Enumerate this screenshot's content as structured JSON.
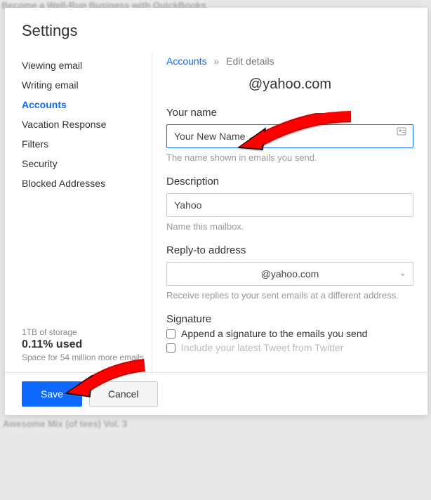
{
  "bgTextTop": "Become a Well-Run Business with QuickBooks",
  "bgTextBottom": "Awesome Mix (of tees) Vol. 3",
  "modal": {
    "title": "Settings"
  },
  "sidebar": {
    "items": [
      {
        "label": "Viewing email",
        "active": false
      },
      {
        "label": "Writing email",
        "active": false
      },
      {
        "label": "Accounts",
        "active": true
      },
      {
        "label": "Vacation Response",
        "active": false
      },
      {
        "label": "Filters",
        "active": false
      },
      {
        "label": "Security",
        "active": false
      },
      {
        "label": "Blocked Addresses",
        "active": false
      }
    ]
  },
  "storage": {
    "capacity": "1TB of storage",
    "used": "0.11% used",
    "hint": "Space for 54 million more emails"
  },
  "breadcrumb": {
    "link": "Accounts",
    "current": "Edit details"
  },
  "account": {
    "email": "@yahoo.com"
  },
  "fields": {
    "yourName": {
      "label": "Your name",
      "value": "Your New Name",
      "help": "The name shown in emails you send."
    },
    "description": {
      "label": "Description",
      "value": "Yahoo",
      "help": "Name this mailbox."
    },
    "replyTo": {
      "label": "Reply-to address",
      "value": "@yahoo.com",
      "help": "Receive replies to your sent emails at a different address."
    },
    "signature": {
      "label": "Signature",
      "appendLabel": "Append a signature to the emails you send",
      "tweetLabel": "Include your latest Tweet from Twitter"
    }
  },
  "buttons": {
    "save": "Save",
    "cancel": "Cancel"
  }
}
